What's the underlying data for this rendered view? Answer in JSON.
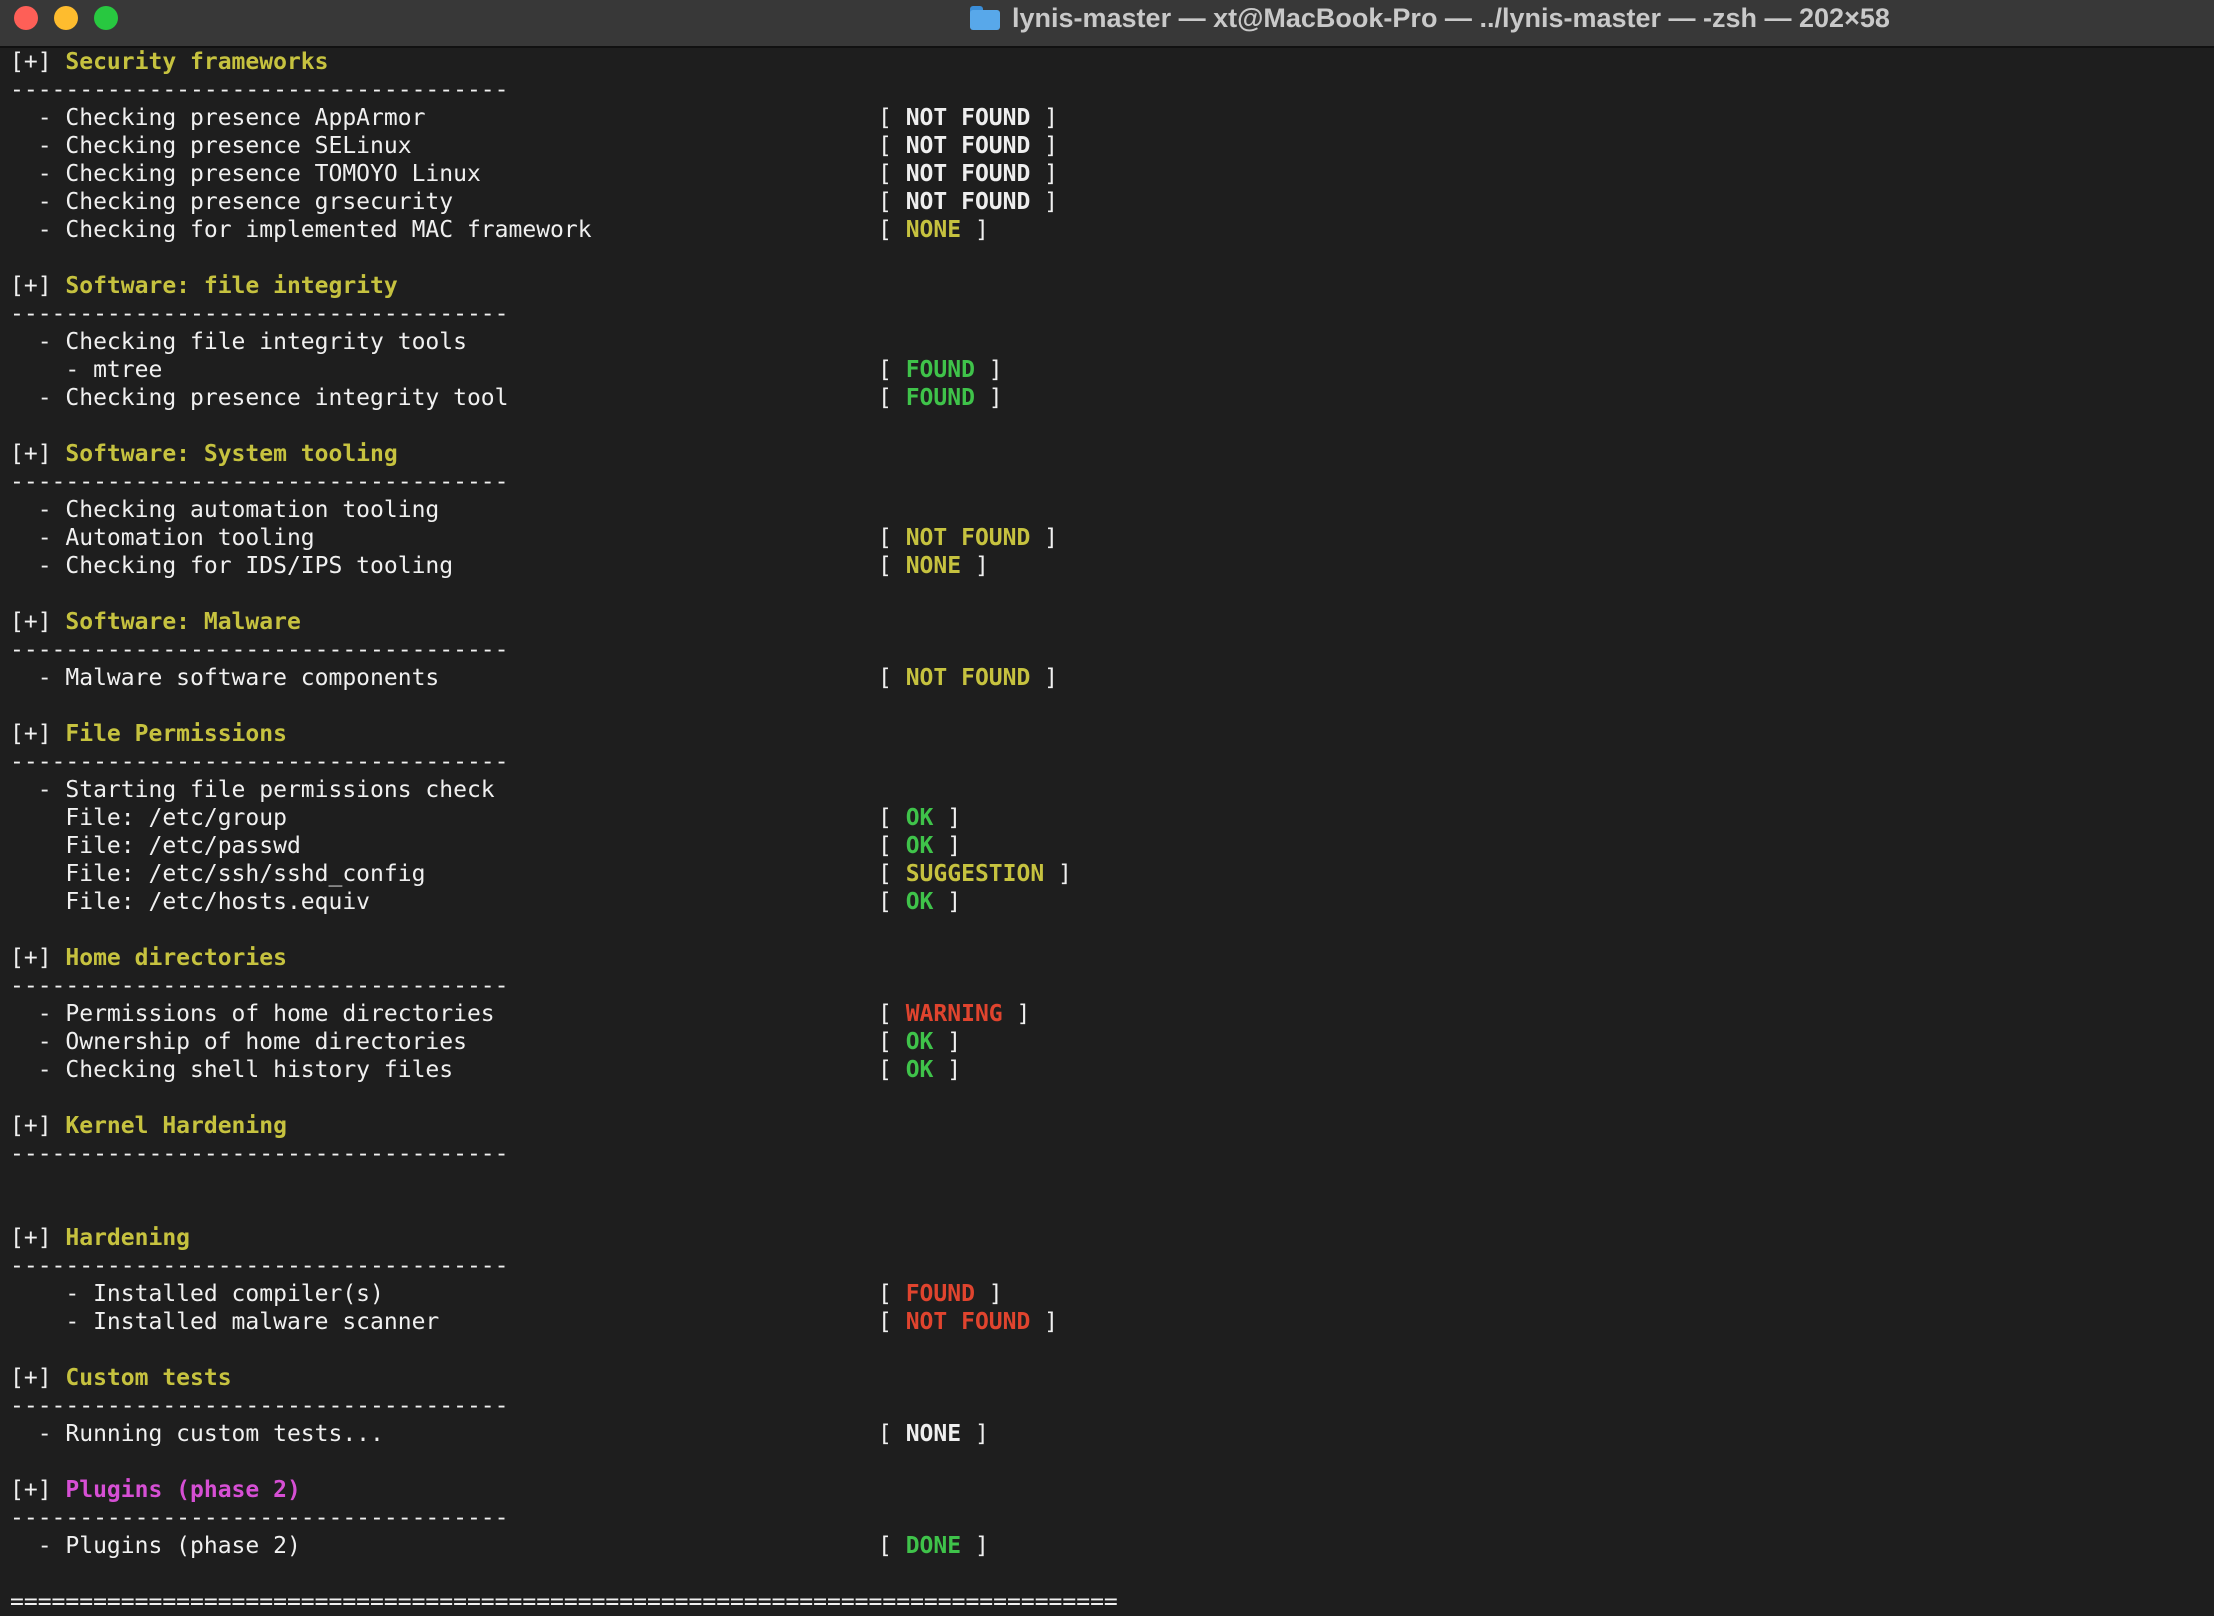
{
  "window": {
    "title": "lynis-master — xt@MacBook-Pro — ../lynis-master — -zsh — 202×58"
  },
  "colors": {
    "background": "#1e1e1e",
    "section_header": "#c6c23f",
    "plugin_header": "#d64fd4",
    "status_green": "#3fc34a",
    "status_yellow": "#c6c23f",
    "status_red": "#e0442e",
    "status_white": "#eeeeee"
  },
  "terminal": {
    "lines": [
      {
        "type": "header",
        "prefix": "[+] ",
        "text": "Security frameworks",
        "color": "yellow"
      },
      {
        "type": "text",
        "text": "------------------------------------"
      },
      {
        "type": "check",
        "label": "  - Checking presence AppArmor",
        "status": "NOT FOUND",
        "color": "white"
      },
      {
        "type": "check",
        "label": "  - Checking presence SELinux",
        "status": "NOT FOUND",
        "color": "white"
      },
      {
        "type": "check",
        "label": "  - Checking presence TOMOYO Linux",
        "status": "NOT FOUND",
        "color": "white"
      },
      {
        "type": "check",
        "label": "  - Checking presence grsecurity",
        "status": "NOT FOUND",
        "color": "white"
      },
      {
        "type": "check",
        "label": "  - Checking for implemented MAC framework",
        "status": "NONE",
        "color": "yellow"
      },
      {
        "type": "blank"
      },
      {
        "type": "header",
        "prefix": "[+] ",
        "text": "Software: file integrity",
        "color": "yellow"
      },
      {
        "type": "text",
        "text": "------------------------------------"
      },
      {
        "type": "text",
        "text": "  - Checking file integrity tools"
      },
      {
        "type": "check",
        "label": "    - mtree",
        "status": "FOUND",
        "color": "green"
      },
      {
        "type": "check",
        "label": "  - Checking presence integrity tool",
        "status": "FOUND",
        "color": "green"
      },
      {
        "type": "blank"
      },
      {
        "type": "header",
        "prefix": "[+] ",
        "text": "Software: System tooling",
        "color": "yellow"
      },
      {
        "type": "text",
        "text": "------------------------------------"
      },
      {
        "type": "text",
        "text": "  - Checking automation tooling"
      },
      {
        "type": "check",
        "label": "  - Automation tooling",
        "status": "NOT FOUND",
        "color": "yellow"
      },
      {
        "type": "check",
        "label": "  - Checking for IDS/IPS tooling",
        "status": "NONE",
        "color": "yellow"
      },
      {
        "type": "blank"
      },
      {
        "type": "header",
        "prefix": "[+] ",
        "text": "Software: Malware",
        "color": "yellow"
      },
      {
        "type": "text",
        "text": "------------------------------------"
      },
      {
        "type": "check",
        "label": "  - Malware software components",
        "status": "NOT FOUND",
        "color": "yellow"
      },
      {
        "type": "blank"
      },
      {
        "type": "header",
        "prefix": "[+] ",
        "text": "File Permissions",
        "color": "yellow"
      },
      {
        "type": "text",
        "text": "------------------------------------"
      },
      {
        "type": "text",
        "text": "  - Starting file permissions check"
      },
      {
        "type": "check",
        "label": "    File: /etc/group",
        "status": "OK",
        "color": "green"
      },
      {
        "type": "check",
        "label": "    File: /etc/passwd",
        "status": "OK",
        "color": "green"
      },
      {
        "type": "check",
        "label": "    File: /etc/ssh/sshd_config",
        "status": "SUGGESTION",
        "color": "yellow"
      },
      {
        "type": "check",
        "label": "    File: /etc/hosts.equiv",
        "status": "OK",
        "color": "green"
      },
      {
        "type": "blank"
      },
      {
        "type": "header",
        "prefix": "[+] ",
        "text": "Home directories",
        "color": "yellow"
      },
      {
        "type": "text",
        "text": "------------------------------------"
      },
      {
        "type": "check",
        "label": "  - Permissions of home directories",
        "status": "WARNING",
        "color": "red"
      },
      {
        "type": "check",
        "label": "  - Ownership of home directories",
        "status": "OK",
        "color": "green"
      },
      {
        "type": "check",
        "label": "  - Checking shell history files",
        "status": "OK",
        "color": "green"
      },
      {
        "type": "blank"
      },
      {
        "type": "header",
        "prefix": "[+] ",
        "text": "Kernel Hardening",
        "color": "yellow"
      },
      {
        "type": "text",
        "text": "------------------------------------"
      },
      {
        "type": "blank"
      },
      {
        "type": "blank"
      },
      {
        "type": "header",
        "prefix": "[+] ",
        "text": "Hardening",
        "color": "yellow"
      },
      {
        "type": "text",
        "text": "------------------------------------"
      },
      {
        "type": "check",
        "label": "    - Installed compiler(s)",
        "status": "FOUND",
        "color": "red"
      },
      {
        "type": "check",
        "label": "    - Installed malware scanner",
        "status": "NOT FOUND",
        "color": "red"
      },
      {
        "type": "blank"
      },
      {
        "type": "header",
        "prefix": "[+] ",
        "text": "Custom tests",
        "color": "yellow"
      },
      {
        "type": "text",
        "text": "------------------------------------"
      },
      {
        "type": "check",
        "label": "  - Running custom tests...",
        "status": "NONE",
        "color": "white"
      },
      {
        "type": "blank"
      },
      {
        "type": "header",
        "prefix": "[+] ",
        "text": "Plugins (phase 2)",
        "color": "magenta"
      },
      {
        "type": "text",
        "text": "------------------------------------"
      },
      {
        "type": "check",
        "label": "  - Plugins (phase 2)",
        "status": "DONE",
        "color": "green"
      },
      {
        "type": "blank"
      },
      {
        "type": "text",
        "text": "================================================================================"
      }
    ]
  }
}
